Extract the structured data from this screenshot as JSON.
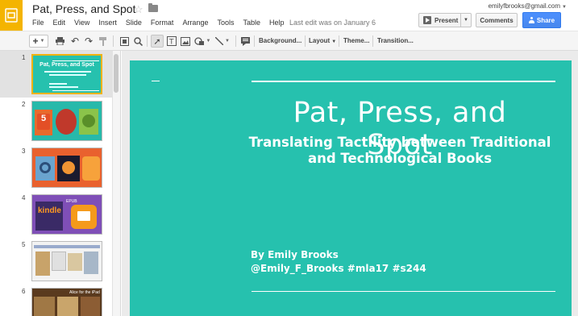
{
  "header": {
    "doc_title": "Pat, Press, and Spot",
    "last_edit": "Last edit was on January 6",
    "account_email": "emilyfbrooks@gmail.com",
    "present_label": "Present",
    "comments_label": "Comments",
    "share_label": "Share"
  },
  "menu": [
    "File",
    "Edit",
    "View",
    "Insert",
    "Slide",
    "Format",
    "Arrange",
    "Tools",
    "Table",
    "Help"
  ],
  "toolbar": {
    "background_label": "Background...",
    "layout_label": "Layout",
    "theme_label": "Theme...",
    "transition_label": "Transition..."
  },
  "filmstrip": {
    "slides": [
      {
        "number": "1"
      },
      {
        "number": "2"
      },
      {
        "number": "3"
      },
      {
        "number": "4",
        "thumb_text_1": "kindle",
        "thumb_text_2": "EPUB"
      },
      {
        "number": "5"
      },
      {
        "number": "6",
        "thumb_text_1": "Alice for the iPad"
      }
    ],
    "thumb1_title": "Pat, Press, and Spot"
  },
  "slide": {
    "title": "Pat, Press, and Spot",
    "subtitle_line1": "Translating Tactility between Traditional",
    "subtitle_line2": "and Technological Books",
    "author_line1": "By Emily Brooks",
    "author_line2": "@Emily_F_Brooks #mla17 #s244",
    "background_color": "#26c1ae"
  },
  "colors": {
    "logo": "#f4b400",
    "share": "#4d90fe",
    "active_thumb_border": "#f0b30f"
  }
}
